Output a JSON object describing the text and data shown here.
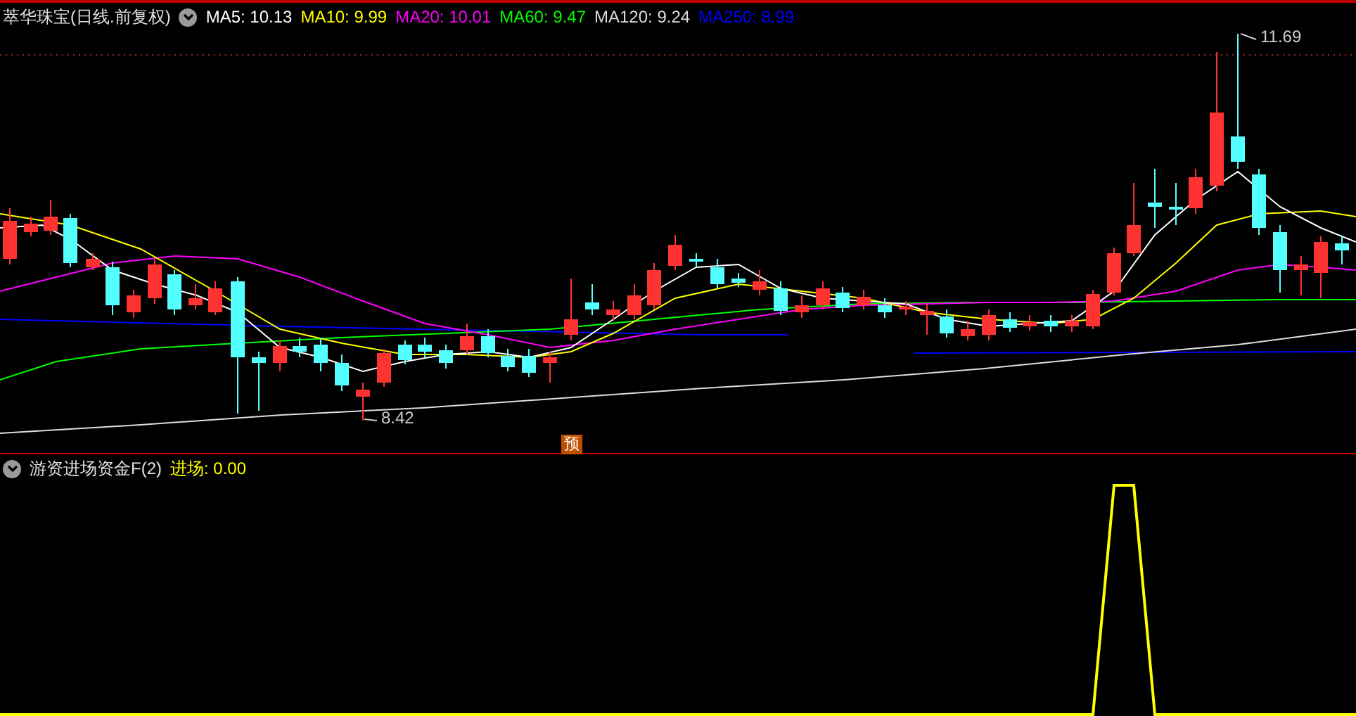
{
  "price_panel": {
    "title": "萃华珠宝(日线.前复权)",
    "ma_legend": [
      {
        "label": "MA5: 10.13",
        "color": "#ffffff"
      },
      {
        "label": "MA10: 9.99",
        "color": "#ffff00"
      },
      {
        "label": "MA20: 10.01",
        "color": "#ff00ff"
      },
      {
        "label": "MA60: 9.47",
        "color": "#00ff00"
      },
      {
        "label": "MA120: 9.24",
        "color": "#dddddd"
      },
      {
        "label": "MA250: 8.99",
        "color": "#0000ff"
      }
    ],
    "high_label": "11.69",
    "low_label": "8.42",
    "marker": "预"
  },
  "indicator_panel": {
    "title": "游资进场资金F(2)",
    "legend": "进场: 0.00"
  }
}
